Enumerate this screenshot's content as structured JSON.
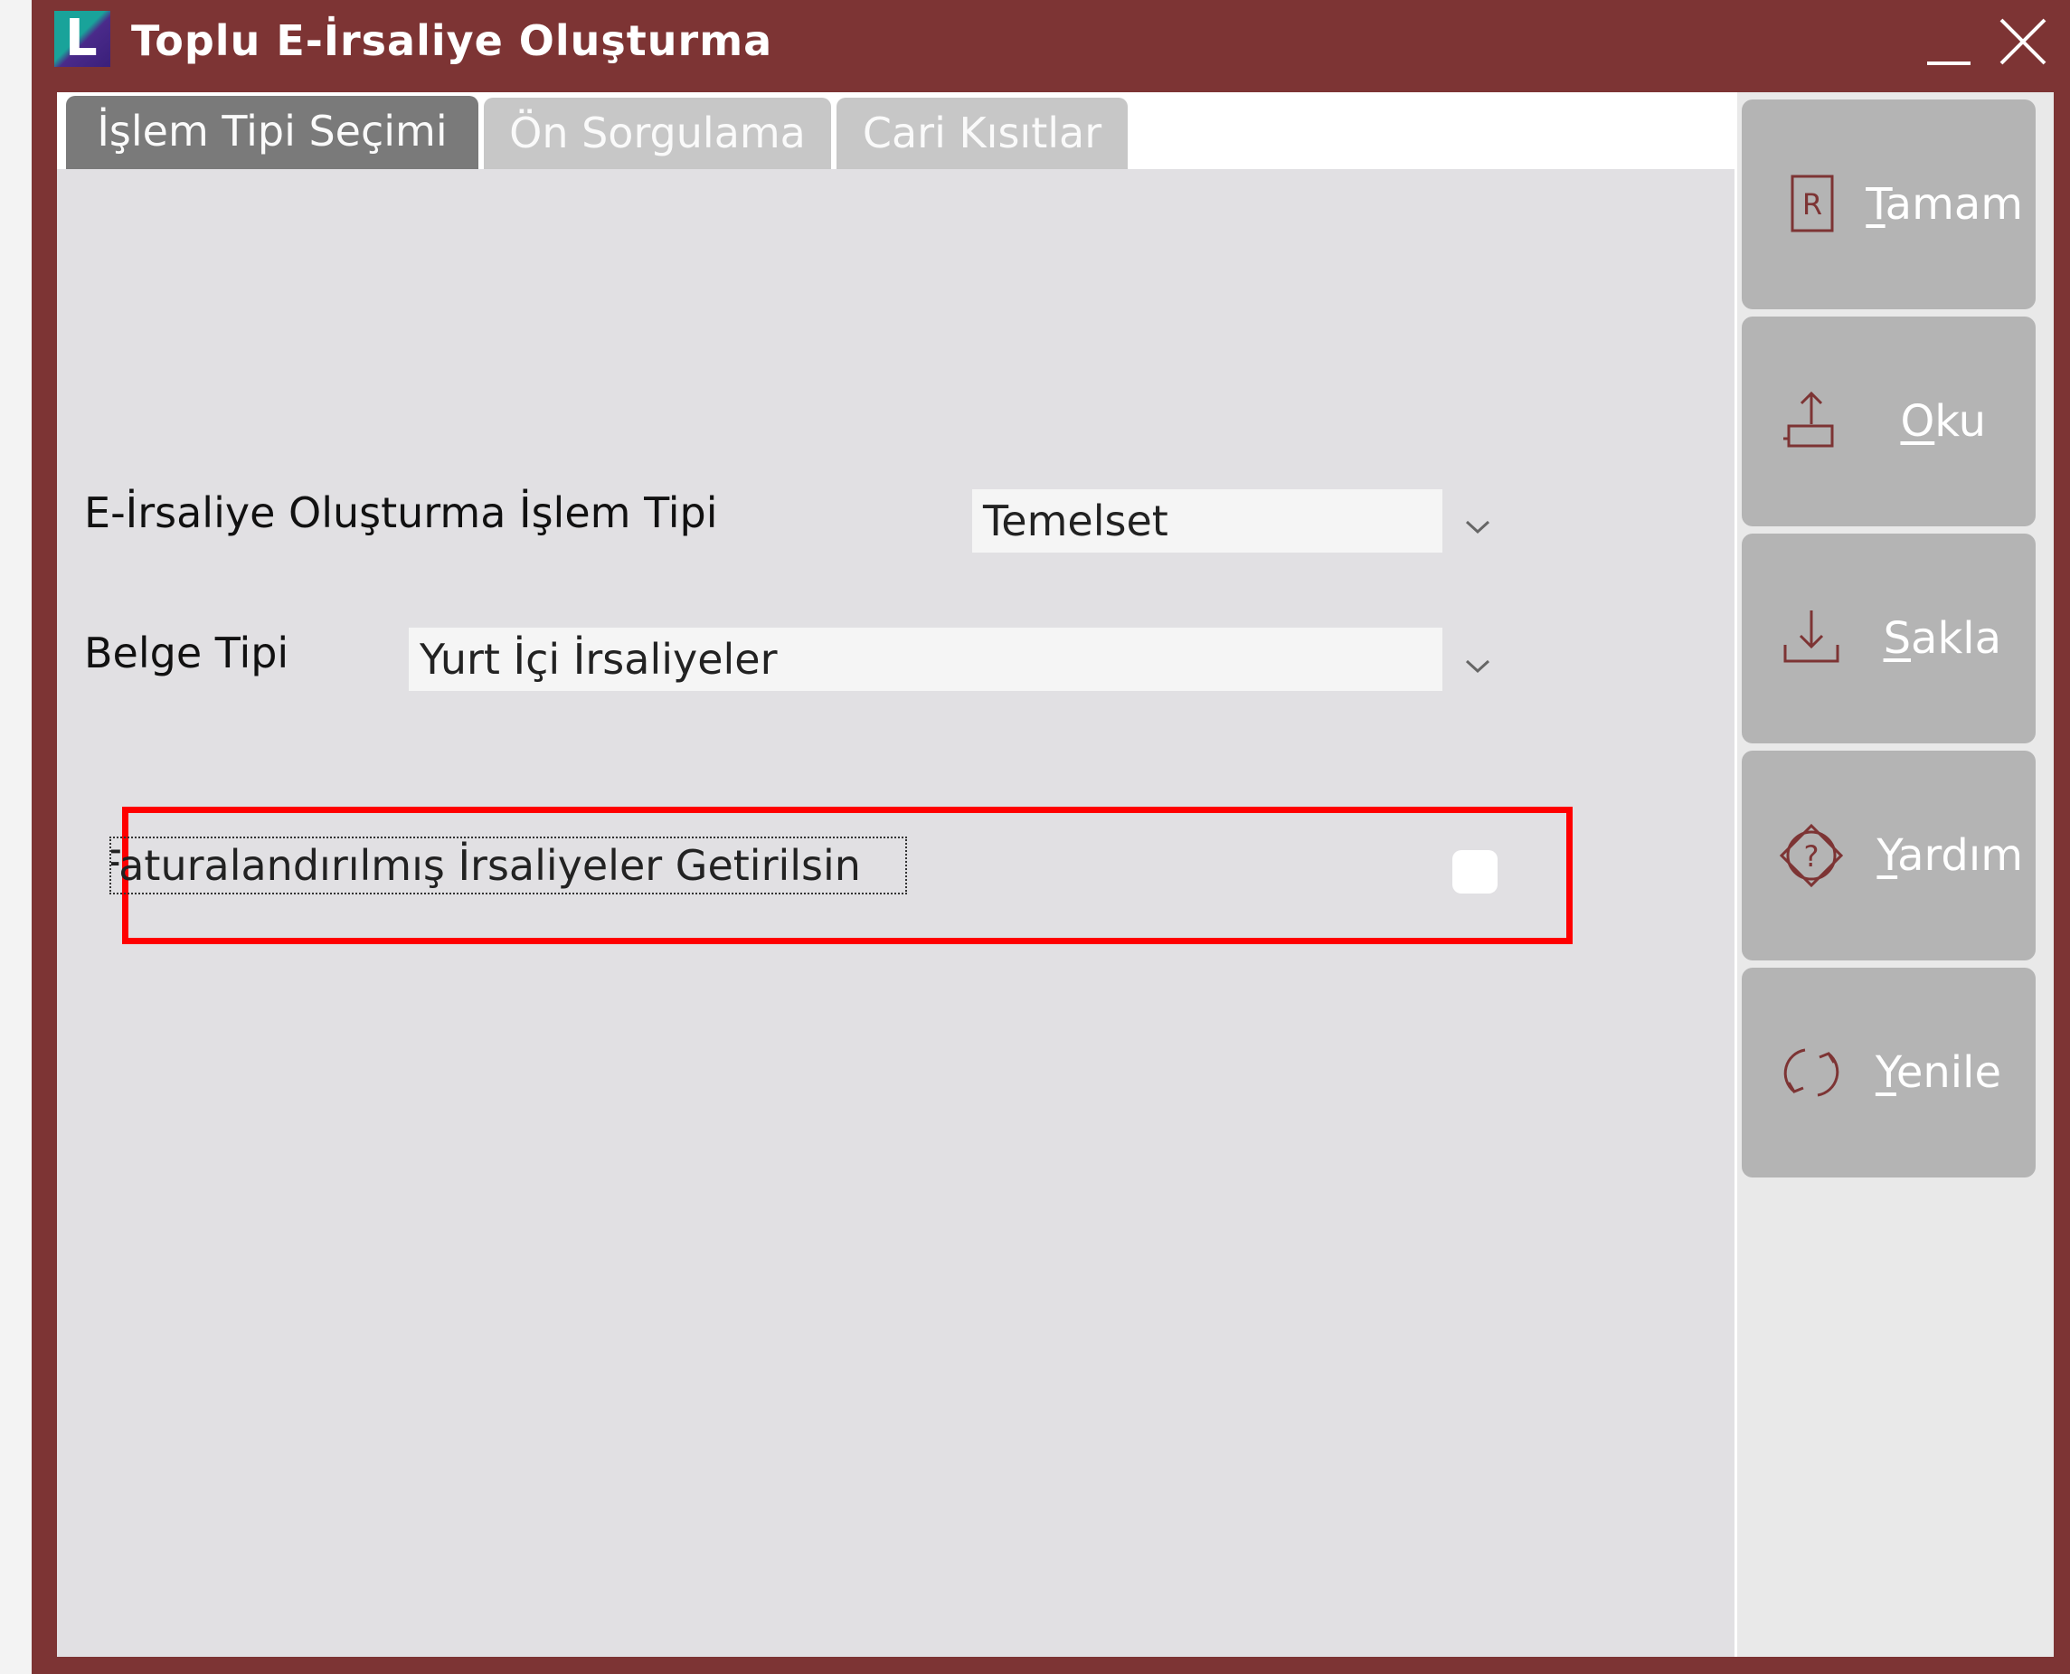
{
  "window": {
    "title": "Toplu E-İrsaliye Oluşturma",
    "logo_letter": "L",
    "accent_color": "#7d3434"
  },
  "tabs": [
    {
      "label": "İşlem Tipi Seçimi",
      "active": true
    },
    {
      "label": "Ön Sorgulama",
      "active": false
    },
    {
      "label": "Cari Kısıtlar",
      "active": false
    }
  ],
  "form": {
    "islem_tipi": {
      "label": "E-İrsaliye Oluşturma İşlem Tipi",
      "value": "Temelset"
    },
    "belge_tipi": {
      "label": "Belge Tipi",
      "value": "Yurt İçi İrsaliyeler"
    },
    "faturalandirilmis": {
      "label": "Faturalandırılmış İrsaliyeler Getirilsin",
      "checked": false
    }
  },
  "sidebar": {
    "buttons": [
      {
        "key": "T",
        "rest": "amam",
        "icon": "report-icon"
      },
      {
        "key": "O",
        "rest": "ku",
        "icon": "upload-icon"
      },
      {
        "key": "S",
        "rest": "akla",
        "icon": "download-icon"
      },
      {
        "key": "Y",
        "rest": "ardım",
        "icon": "help-icon"
      },
      {
        "key": "Y",
        "rest": "enile",
        "icon": "refresh-icon"
      }
    ]
  }
}
